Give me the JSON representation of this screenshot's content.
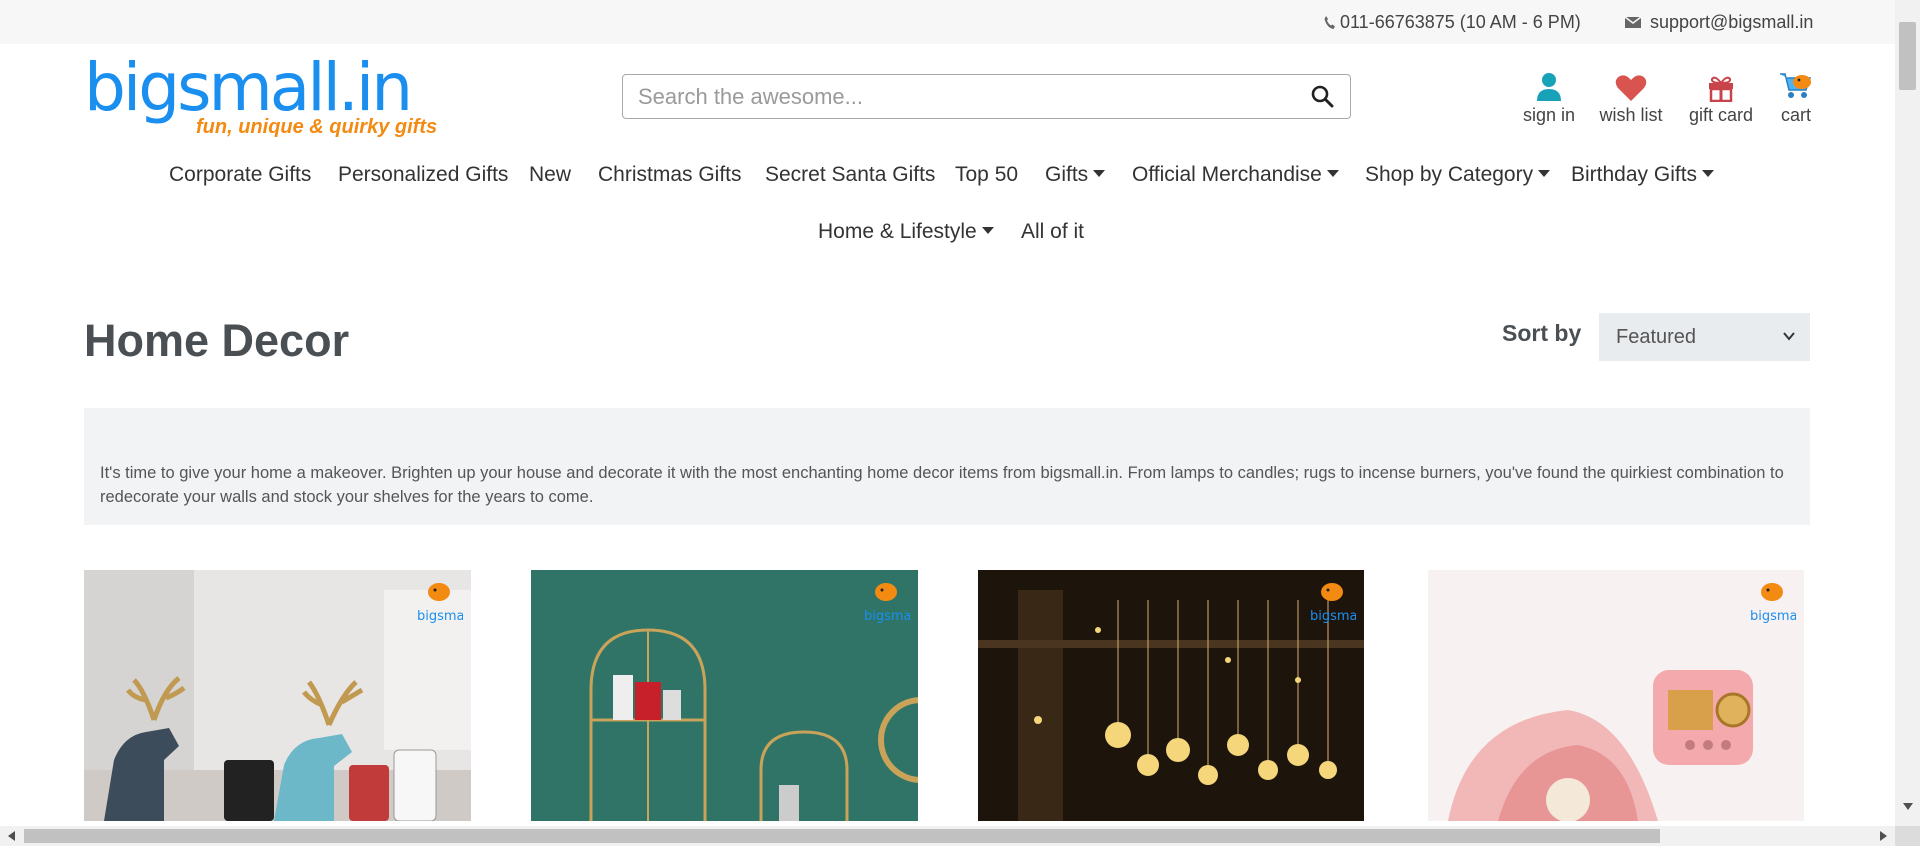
{
  "topbar": {
    "phone": "011-66763875 (10 AM - 6 PM)",
    "email": "support@bigsmall.in",
    "phone_icon": "phone-icon",
    "email_icon": "envelope-icon"
  },
  "logo": {
    "brand": "bigsmall.in",
    "tagline": "fun, unique & quirky gifts"
  },
  "search": {
    "placeholder": "Search the awesome...",
    "icon": "search-icon"
  },
  "header_actions": [
    {
      "label": "sign in",
      "icon": "user-icon"
    },
    {
      "label": "wish list",
      "icon": "heart-icon"
    },
    {
      "label": "gift card",
      "icon": "gift-icon"
    },
    {
      "label": "cart",
      "icon": "cart-icon"
    }
  ],
  "nav": {
    "row1": [
      {
        "label": "Corporate Gifts"
      },
      {
        "label": "Personalized Gifts"
      },
      {
        "label": "New"
      },
      {
        "label": "Christmas Gifts"
      },
      {
        "label": "Secret Santa Gifts"
      },
      {
        "label": "Top 50"
      },
      {
        "label": "Gifts"
      },
      {
        "label": "Official Merchandise"
      },
      {
        "label": "Shop by Category"
      },
      {
        "label": "Birthday Gifts"
      }
    ],
    "row2": [
      {
        "label": "Home & Lifestyle"
      },
      {
        "label": "All of it"
      }
    ]
  },
  "page": {
    "title": "Home Decor",
    "sort_label": "Sort by",
    "sort_value": "Featured",
    "description": "It's time to give your home a makeover. Brighten up your house and decorate it with the most enchanting home decor items from bigsmall.in. From lamps to candles; rugs to incense burners, you've found the quirkiest combination to redecorate your walls and stock your shelves for the years to come."
  },
  "colors": {
    "brand_blue": "#1a8ff0",
    "brand_orange": "#f38a12",
    "wishlist_red": "#d9534f",
    "signin_teal": "#17a2b8"
  }
}
